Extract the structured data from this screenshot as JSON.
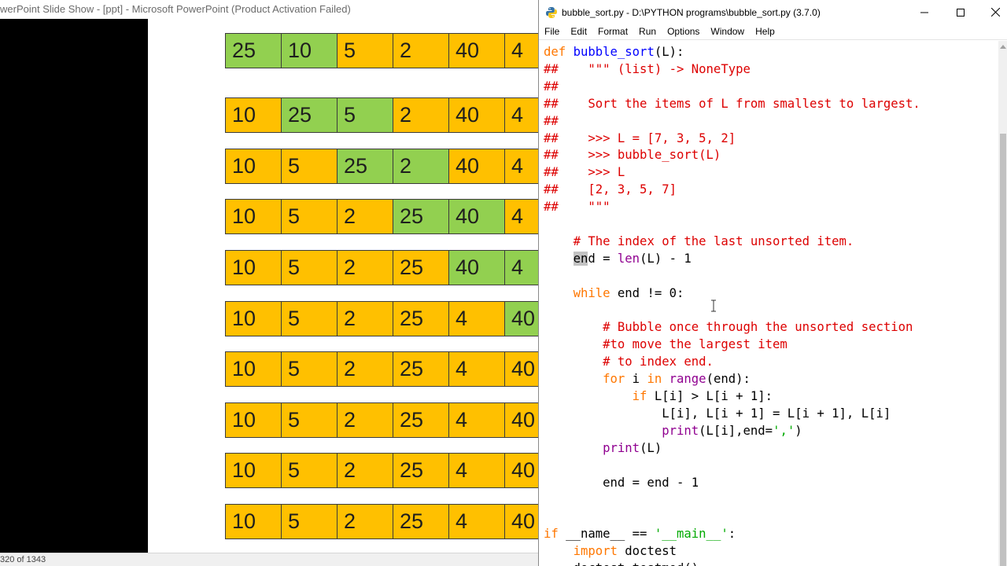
{
  "powerpoint": {
    "title": "werPoint Slide Show - [ppt] - Microsoft PowerPoint (Product Activation Failed)",
    "status": "320 of 1343",
    "rows": [
      {
        "cells": [
          {
            "v": "25",
            "c": "green"
          },
          {
            "v": "10",
            "c": "green"
          },
          {
            "v": "5",
            "c": "orange"
          },
          {
            "v": "2",
            "c": "orange"
          },
          {
            "v": "40",
            "c": "orange"
          },
          {
            "v": "4",
            "c": "orange"
          }
        ]
      },
      {
        "cells": [
          {
            "v": "10",
            "c": "orange"
          },
          {
            "v": "25",
            "c": "green"
          },
          {
            "v": "5",
            "c": "green"
          },
          {
            "v": "2",
            "c": "orange"
          },
          {
            "v": "40",
            "c": "orange"
          },
          {
            "v": "4",
            "c": "orange"
          }
        ]
      },
      {
        "cells": [
          {
            "v": "10",
            "c": "orange"
          },
          {
            "v": "5",
            "c": "orange"
          },
          {
            "v": "25",
            "c": "green"
          },
          {
            "v": "2",
            "c": "green"
          },
          {
            "v": "40",
            "c": "orange"
          },
          {
            "v": "4",
            "c": "orange"
          }
        ]
      },
      {
        "cells": [
          {
            "v": "10",
            "c": "orange"
          },
          {
            "v": "5",
            "c": "orange"
          },
          {
            "v": "2",
            "c": "orange"
          },
          {
            "v": "25",
            "c": "green"
          },
          {
            "v": "40",
            "c": "green"
          },
          {
            "v": "4",
            "c": "orange"
          }
        ]
      },
      {
        "cells": [
          {
            "v": "10",
            "c": "orange"
          },
          {
            "v": "5",
            "c": "orange"
          },
          {
            "v": "2",
            "c": "orange"
          },
          {
            "v": "25",
            "c": "orange"
          },
          {
            "v": "40",
            "c": "green"
          },
          {
            "v": "4",
            "c": "green"
          }
        ]
      },
      {
        "cells": [
          {
            "v": "10",
            "c": "orange"
          },
          {
            "v": "5",
            "c": "orange"
          },
          {
            "v": "2",
            "c": "orange"
          },
          {
            "v": "25",
            "c": "orange"
          },
          {
            "v": "4",
            "c": "orange"
          },
          {
            "v": "40",
            "c": "green"
          }
        ]
      },
      {
        "cells": [
          {
            "v": "10",
            "c": "orange"
          },
          {
            "v": "5",
            "c": "orange"
          },
          {
            "v": "2",
            "c": "orange"
          },
          {
            "v": "25",
            "c": "orange"
          },
          {
            "v": "4",
            "c": "orange"
          },
          {
            "v": "40",
            "c": "orange"
          }
        ]
      },
      {
        "cells": [
          {
            "v": "10",
            "c": "orange"
          },
          {
            "v": "5",
            "c": "orange"
          },
          {
            "v": "2",
            "c": "orange"
          },
          {
            "v": "25",
            "c": "orange"
          },
          {
            "v": "4",
            "c": "orange"
          },
          {
            "v": "40",
            "c": "orange"
          }
        ]
      },
      {
        "cells": [
          {
            "v": "10",
            "c": "orange"
          },
          {
            "v": "5",
            "c": "orange"
          },
          {
            "v": "2",
            "c": "orange"
          },
          {
            "v": "25",
            "c": "orange"
          },
          {
            "v": "4",
            "c": "orange"
          },
          {
            "v": "40",
            "c": "orange"
          }
        ]
      },
      {
        "cells": [
          {
            "v": "10",
            "c": "orange"
          },
          {
            "v": "5",
            "c": "orange"
          },
          {
            "v": "2",
            "c": "orange"
          },
          {
            "v": "25",
            "c": "orange"
          },
          {
            "v": "4",
            "c": "orange"
          },
          {
            "v": "40",
            "c": "orange"
          }
        ]
      }
    ]
  },
  "idle": {
    "title": "bubble_sort.py - D:\\PYTHON programs\\bubble_sort.py (3.7.0)",
    "menu": [
      "File",
      "Edit",
      "Format",
      "Run",
      "Options",
      "Window",
      "Help"
    ],
    "code": [
      [
        {
          "t": "def ",
          "s": "k"
        },
        {
          "t": "bubble_sort",
          "s": "d"
        },
        {
          "t": "(L):",
          "s": ""
        }
      ],
      [
        {
          "t": "##    \"\"\" (list) -> NoneType",
          "s": "c"
        }
      ],
      [
        {
          "t": "##",
          "s": "c"
        }
      ],
      [
        {
          "t": "##    Sort the items of L from smallest to largest.",
          "s": "c"
        }
      ],
      [
        {
          "t": "##",
          "s": "c"
        }
      ],
      [
        {
          "t": "##    >>> L = [7, 3, 5, 2]",
          "s": "c"
        }
      ],
      [
        {
          "t": "##    >>> bubble_sort(L)",
          "s": "c"
        }
      ],
      [
        {
          "t": "##    >>> L",
          "s": "c"
        }
      ],
      [
        {
          "t": "##    [2, 3, 5, 7]",
          "s": "c"
        }
      ],
      [
        {
          "t": "##    \"\"\"",
          "s": "c"
        }
      ],
      [
        {
          "t": "",
          "s": ""
        }
      ],
      [
        {
          "t": "    ",
          "s": ""
        },
        {
          "t": "# The index of the last unsorted item.",
          "s": "c"
        }
      ],
      [
        {
          "t": "    ",
          "s": ""
        },
        {
          "t": "en",
          "s": "sel"
        },
        {
          "t": "d = ",
          "s": ""
        },
        {
          "t": "len",
          "s": "b"
        },
        {
          "t": "(L) - 1",
          "s": ""
        }
      ],
      [
        {
          "t": "",
          "s": ""
        }
      ],
      [
        {
          "t": "    ",
          "s": ""
        },
        {
          "t": "while",
          "s": "k"
        },
        {
          "t": " end != 0:",
          "s": ""
        }
      ],
      [
        {
          "t": "",
          "s": ""
        }
      ],
      [
        {
          "t": "        ",
          "s": ""
        },
        {
          "t": "# Bubble once through the unsorted section",
          "s": "c"
        }
      ],
      [
        {
          "t": "        ",
          "s": ""
        },
        {
          "t": "#to move the largest item",
          "s": "c"
        }
      ],
      [
        {
          "t": "        ",
          "s": ""
        },
        {
          "t": "# to index end.",
          "s": "c"
        }
      ],
      [
        {
          "t": "        ",
          "s": ""
        },
        {
          "t": "for",
          "s": "k"
        },
        {
          "t": " i ",
          "s": ""
        },
        {
          "t": "in",
          "s": "k"
        },
        {
          "t": " ",
          "s": ""
        },
        {
          "t": "range",
          "s": "b"
        },
        {
          "t": "(end):",
          "s": ""
        }
      ],
      [
        {
          "t": "            ",
          "s": ""
        },
        {
          "t": "if",
          "s": "k"
        },
        {
          "t": " L[i] > L[i + 1]:",
          "s": ""
        }
      ],
      [
        {
          "t": "                L[i], L[i + 1] = L[i + 1], L[i]",
          "s": ""
        }
      ],
      [
        {
          "t": "                ",
          "s": ""
        },
        {
          "t": "print",
          "s": "b"
        },
        {
          "t": "(L[i],end=",
          "s": ""
        },
        {
          "t": "','",
          "s": "s"
        },
        {
          "t": ")",
          "s": ""
        }
      ],
      [
        {
          "t": "        ",
          "s": ""
        },
        {
          "t": "print",
          "s": "b"
        },
        {
          "t": "(L)",
          "s": ""
        }
      ],
      [
        {
          "t": "",
          "s": ""
        }
      ],
      [
        {
          "t": "        end = end - 1",
          "s": ""
        }
      ],
      [
        {
          "t": "",
          "s": ""
        }
      ],
      [
        {
          "t": "",
          "s": ""
        }
      ],
      [
        {
          "t": "if",
          "s": "k"
        },
        {
          "t": " __name__ == ",
          "s": ""
        },
        {
          "t": "'__main__'",
          "s": "s"
        },
        {
          "t": ":",
          "s": ""
        }
      ],
      [
        {
          "t": "    ",
          "s": ""
        },
        {
          "t": "import",
          "s": "k"
        },
        {
          "t": " doctest",
          "s": ""
        }
      ],
      [
        {
          "t": "    doctest.testmod()",
          "s": ""
        }
      ]
    ]
  }
}
